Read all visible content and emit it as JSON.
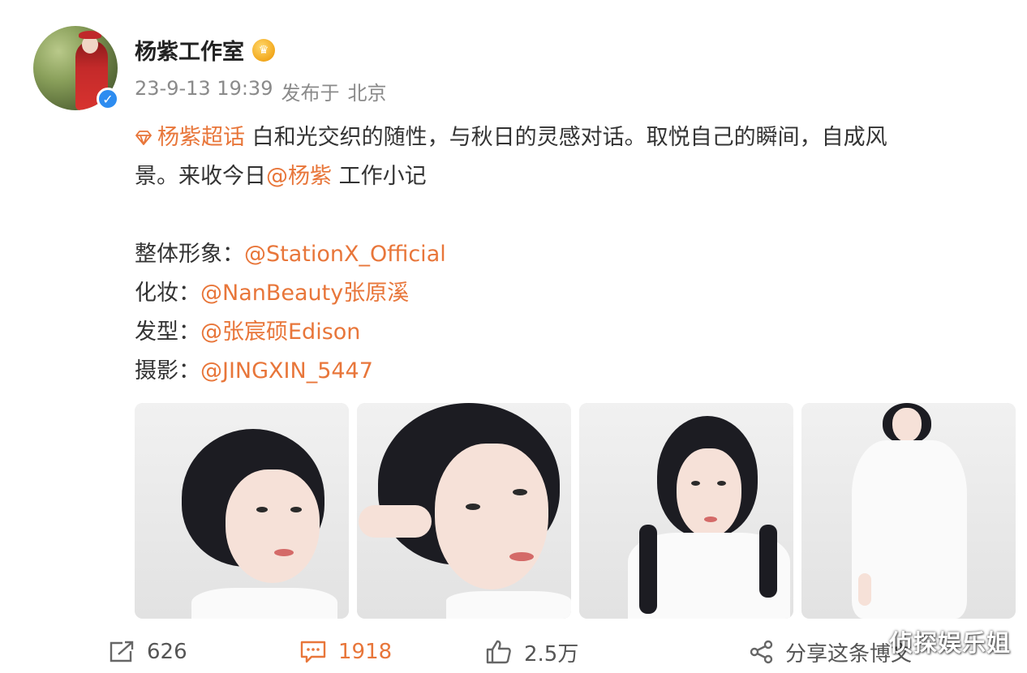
{
  "author": {
    "name": "杨紫工作室",
    "verified": true,
    "badge": "vip-crown-icon"
  },
  "post_meta": {
    "datetime": "23-9-13 19:39",
    "published_label": "发布于",
    "location": "北京"
  },
  "content": {
    "topic": "杨紫超话",
    "line1": "白和光交织的随性，与秋日的灵感对话。取悦自己的瞬间，自成风",
    "line2_start": "景。来收今日",
    "mention": "@杨紫",
    "line2_end": " 工作小记",
    "credits": [
      {
        "label": "整体形象：",
        "handle": "@StationX_Official"
      },
      {
        "label": "化妆：",
        "handle": "@NanBeauty张原溪"
      },
      {
        "label": "发型：",
        "handle": "@张宸硕Edison"
      },
      {
        "label": "摄影：",
        "handle": "@JINGXIN_5447"
      }
    ]
  },
  "actions": {
    "repost": "626",
    "comment": "1918",
    "like": "2.5万",
    "share": "分享这条博文"
  },
  "watermark": "侦探娱乐姐",
  "colors": {
    "link": "#e8763a",
    "meta": "#8a8a8a",
    "verify": "#2d8cf0"
  }
}
